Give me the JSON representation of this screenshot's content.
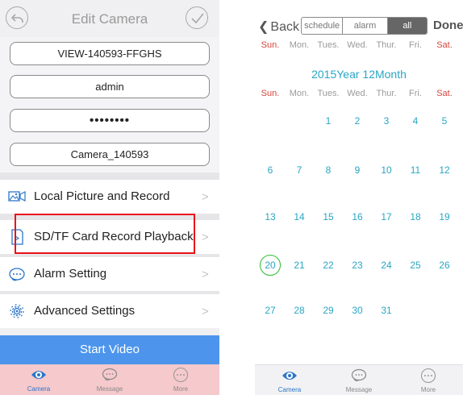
{
  "left": {
    "title": "Edit Camera",
    "fields": [
      {
        "id": "device-id",
        "value": "VIEW-140593-FFGHS"
      },
      {
        "id": "username",
        "value": "admin"
      },
      {
        "id": "password",
        "value": "••••••••"
      },
      {
        "id": "camera-name",
        "value": "Camera_140593"
      }
    ],
    "menu": [
      {
        "label": "Local Picture and Record",
        "icon": "picture-icon"
      },
      {
        "label": "SD/TF Card Record Playback",
        "icon": "sd-card-icon"
      },
      {
        "label": "Alarm Setting",
        "icon": "alarm-icon"
      },
      {
        "label": "Advanced Settings",
        "icon": "gear-icon"
      }
    ],
    "chevron": ">",
    "start_video": "Start Video",
    "tabs": [
      {
        "label": "Camera",
        "icon": "eye-icon"
      },
      {
        "label": "Message",
        "icon": "message-icon"
      },
      {
        "label": "More",
        "icon": "more-icon"
      }
    ]
  },
  "right": {
    "back": "Back",
    "segments": [
      "schedule",
      "alarm",
      "all"
    ],
    "done": "Done",
    "weekdays": [
      "Sun.",
      "Mon.",
      "Tues.",
      "Wed.",
      "Thur.",
      "Fri.",
      "Sat."
    ],
    "month_label": "2015Year 12Month",
    "days": [
      "1",
      "2",
      "3",
      "4",
      "5",
      "6",
      "7",
      "8",
      "9",
      "10",
      "11",
      "12",
      "13",
      "14",
      "15",
      "16",
      "17",
      "18",
      "19",
      "20",
      "21",
      "22",
      "23",
      "24",
      "25",
      "26",
      "27",
      "28",
      "29",
      "30",
      "31"
    ],
    "selected_day": "20",
    "tabs": [
      {
        "label": "Camera",
        "icon": "eye-icon"
      },
      {
        "label": "Message",
        "icon": "message-icon"
      },
      {
        "label": "More",
        "icon": "more-icon"
      }
    ]
  },
  "colors": {
    "accent_blue": "#4d95ec",
    "calendar_teal": "#2aa6c4",
    "weekend_red": "#d7453d",
    "highlight_red": "#e8121b",
    "today_green": "#2bbd2f",
    "tab_bg_left": "#f6c9cc"
  }
}
